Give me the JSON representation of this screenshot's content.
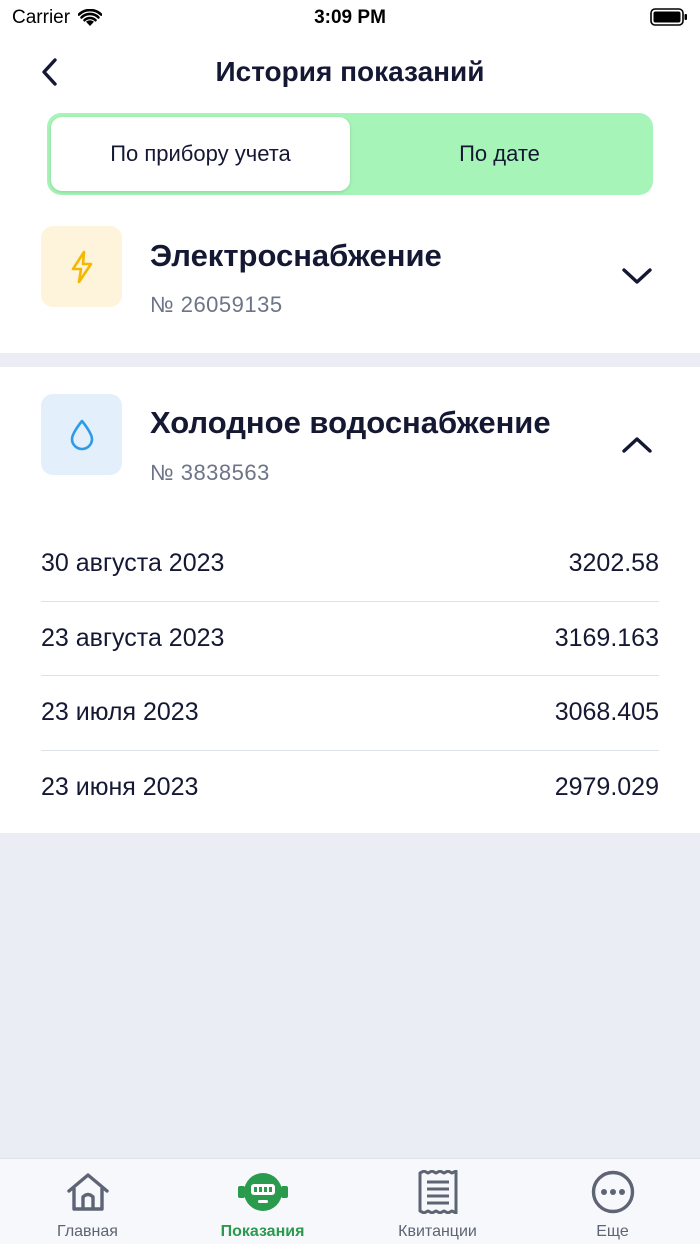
{
  "status_bar": {
    "carrier": "Carrier",
    "time": "3:09 PM"
  },
  "header": {
    "title": "История показаний",
    "back_icon": "chevron-left-icon"
  },
  "segment": {
    "options": [
      {
        "label": "По прибору учета",
        "active": true
      },
      {
        "label": "По дате",
        "active": false
      }
    ]
  },
  "meters": [
    {
      "title": "Электроснабжение",
      "number": "№ 26059135",
      "icon": "lightning-icon",
      "icon_color": "#f5b800",
      "icon_bg": "#fdf4db",
      "expanded": false
    },
    {
      "title": "Холодное водоснабжение",
      "number": "№ 3838563",
      "icon": "water-drop-icon",
      "icon_color": "#2f9be8",
      "icon_bg": "#e3f0fb",
      "expanded": true,
      "readings": [
        {
          "date": "30 августа 2023",
          "value": "3202.58"
        },
        {
          "date": "23 августа 2023",
          "value": "3169.163"
        },
        {
          "date": "23 июля 2023",
          "value": "3068.405"
        },
        {
          "date": "23 июня 2023",
          "value": "2979.029"
        }
      ]
    }
  ],
  "tabbar": {
    "tabs": [
      {
        "label": "Главная",
        "icon": "home-icon",
        "active": false
      },
      {
        "label": "Показания",
        "icon": "meter-icon",
        "active": true
      },
      {
        "label": "Квитанции",
        "icon": "receipt-icon",
        "active": false
      },
      {
        "label": "Еще",
        "icon": "more-icon",
        "active": false
      }
    ]
  },
  "colors": {
    "accent": "#2a9a4c",
    "segment_bg": "#a6f4b8",
    "text": "#141833"
  }
}
